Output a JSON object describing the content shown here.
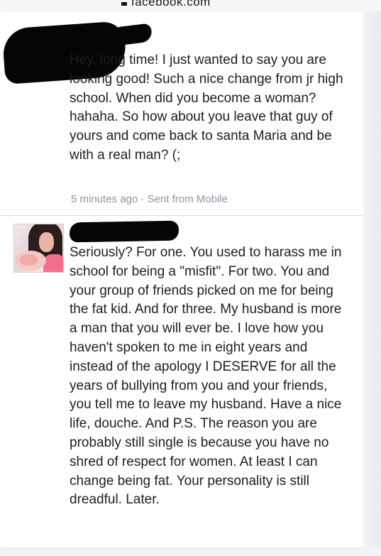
{
  "site": {
    "domain_fragment": "facebook.com"
  },
  "messages": [
    {
      "text": "Hey, long time! I just wanted to say you are looking good! Such a nice change from jr high school. When did you become a woman?hahaha. So how about you leave that guy of yours and come back to santa Maria and be with a real man? (;",
      "timestamp": "5 minutes ago",
      "separator": "·",
      "source": "Sent from Mobile"
    },
    {
      "text": "Seriously? For one. You used to harass me in school for being a \"misfit\". For two. You and your group of friends picked on me for being the fat kid. And for three. My husband is more a man that you will ever be. I love how you haven't spoken to me in eight years and instead of the apology I DESERVE for all the years of bullying from you and your friends, you tell me to leave my husband. Have a nice life, douche. And P.S. The reason you are probably still single is because you have no shred of respect for women. At least I can change being fat. Your personality is still dreadful. Later."
    }
  ],
  "icons": {
    "profile": "profile-photo-icon"
  },
  "colors": {
    "background": "#ffffff",
    "text": "#1c1e21",
    "meta": "#8d949e",
    "redaction": "#050505"
  }
}
